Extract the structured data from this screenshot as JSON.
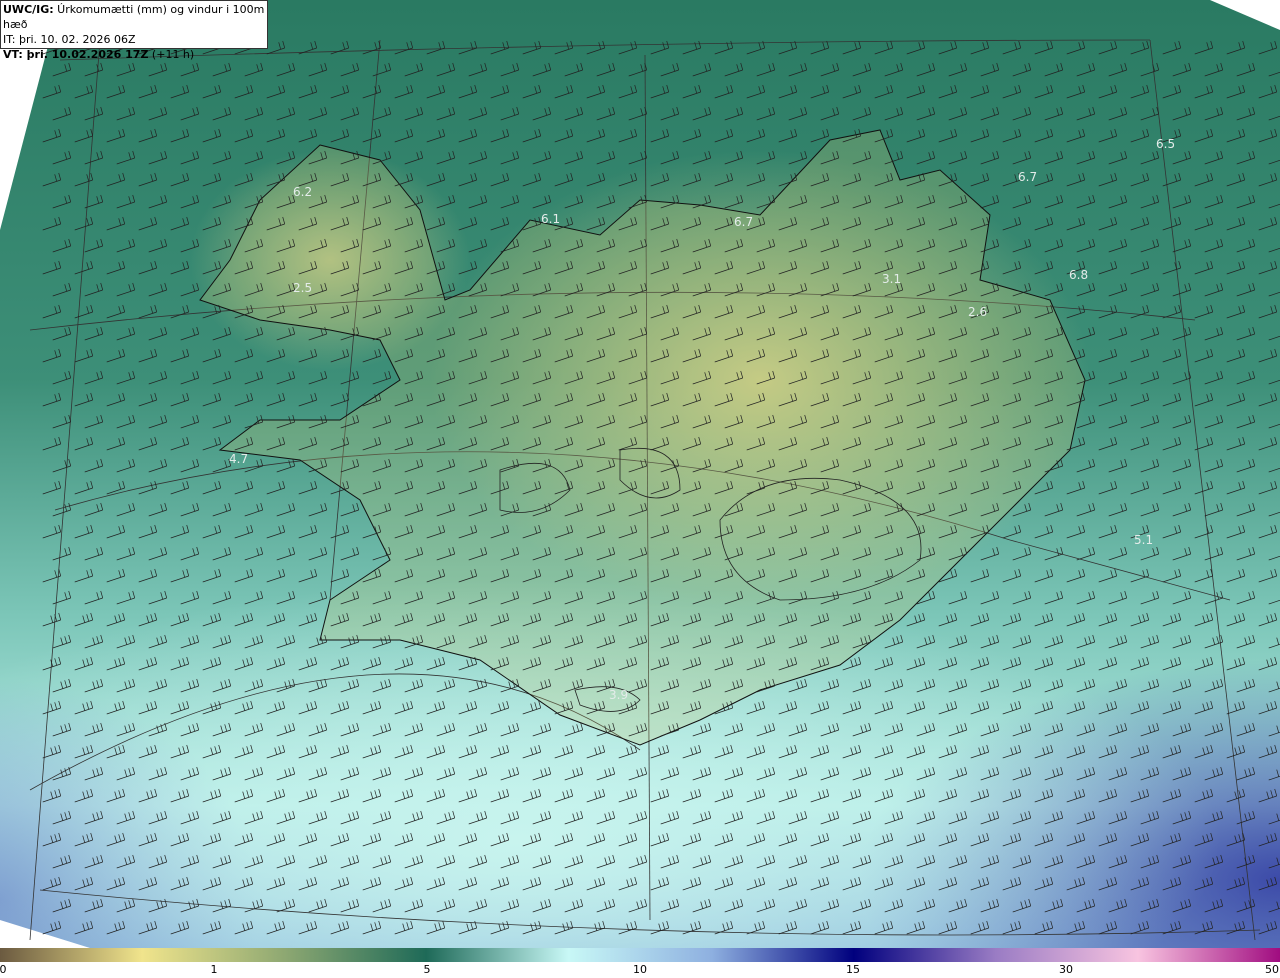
{
  "info": {
    "title_bold": "UWC/IG:",
    "title_rest": " Úrkomumætti (mm) og vindur i 100m hæð",
    "it_line": "IT: þri. 10. 02. 2026 06Z",
    "vt_bold": "VT: þri. 10.02.2026 17Z",
    "vt_rest": " (+11 h)"
  },
  "map_labels": [
    "6.2",
    "6.1",
    "6.7",
    "6.5",
    "6.7",
    "3.1",
    "2.6",
    "6.8",
    "2.5",
    "4.7",
    "5.1",
    "3.9"
  ],
  "colorbar": {
    "ticks": [
      "0",
      "1",
      "5",
      "10",
      "15",
      "30",
      "50"
    ],
    "colors": [
      "#6b5a40",
      "#f0e48c",
      "#8ea872",
      "#1e6a58",
      "#c8f8f6",
      "#8eb0e0",
      "#00007e",
      "#9a7cc4",
      "#f8c4e0",
      "#a00c80"
    ]
  }
}
